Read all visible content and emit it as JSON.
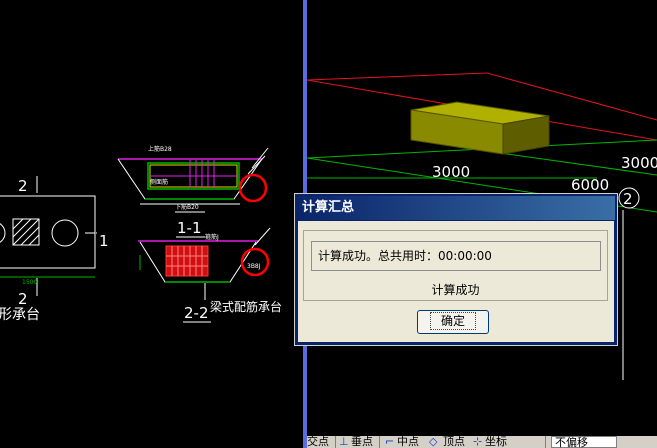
{
  "window": {
    "title": "计算汇总"
  },
  "dialog": {
    "result_text": "计算成功。总共用时：00:00:00",
    "status_text": "计算成功",
    "ok_label": "确定"
  },
  "drawing2d": {
    "label_2_top": "2",
    "label_1_right": "1",
    "label_2_bottom": "2",
    "cap_title_fragment": "形承台",
    "dim_1500": "1500",
    "section_1_1": "1-1",
    "section_2_2": "2-2",
    "beam_cap_title": "梁式配筋承台",
    "note_top_rebar": "上筋B28",
    "note_side_rebar": "侧面筋",
    "note_bottom_rebar": "下筋B20",
    "note_stirrup": "箍筋J",
    "note_3": "3B8J"
  },
  "view3d": {
    "dim_3000_a": "3000",
    "dim_3000_b": "3000",
    "dim_6000": "6000",
    "axis_marker": "2"
  },
  "toolbar": {
    "item_1": "交点",
    "item_2": "垂点",
    "item_3": "中点",
    "item_4": "顶点",
    "item_5": "坐标",
    "dropdown_value": "不偏移"
  },
  "colors": {
    "background": "#000000",
    "divider": "#5a6de0",
    "dialog_title": "#0a246a",
    "dialog_body": "#ece9d8",
    "cap_block": "#8a8a00",
    "grid_red": "#e0141e",
    "grid_green": "#00b400",
    "magenta": "#e020e0",
    "red_circle": "#ff0000"
  }
}
